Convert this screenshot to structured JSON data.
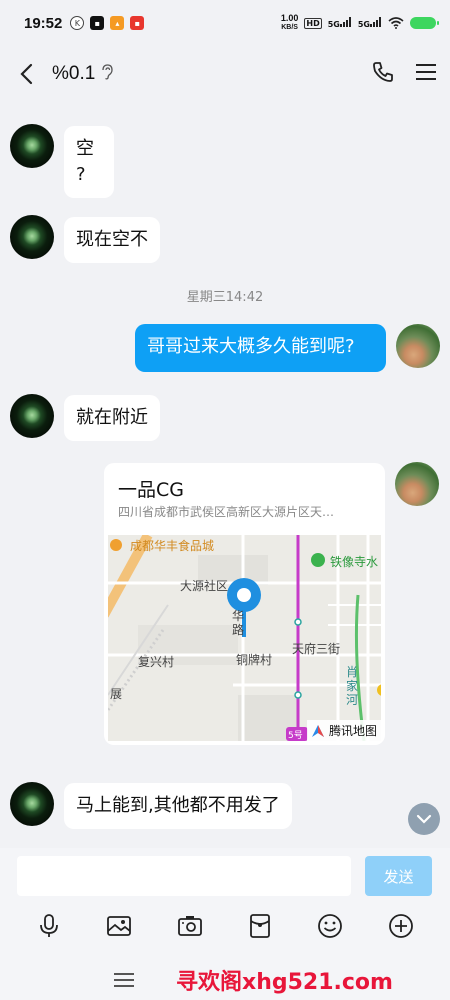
{
  "status_bar": {
    "time": "19:52",
    "net_speed_value": "1.00",
    "net_speed_unit": "KB/S",
    "hd": "HD",
    "signal_1": "5G",
    "signal_2": "5G",
    "battery_color": "#3dd65f",
    "mini_icons": [
      "k-icon",
      "app-icon-1",
      "app-icon-2",
      "app-icon-3"
    ]
  },
  "header": {
    "title": "%0.1",
    "icons": [
      "back-arrow-icon",
      "ear-icon",
      "phone-icon",
      "menu-icon"
    ]
  },
  "messages": [
    {
      "from": "friend",
      "text_line1": "空",
      "text_line2": "?"
    },
    {
      "from": "friend",
      "text": "现在空不"
    },
    {
      "type": "time",
      "text": "星期三14:42"
    },
    {
      "from": "me",
      "text": "哥哥过来大概多久能到呢?"
    },
    {
      "from": "friend",
      "text": "就在附近"
    },
    {
      "from": "me",
      "type": "location",
      "name": "一品CG",
      "address": "四川省成都市武侯区高新区大源片区天…",
      "map_labels": {
        "poi_food_city": "成都华丰食品城",
        "poi_tiexiang": "铁像寺水",
        "dayuan": "大源社区",
        "hua_lu": "华\n路",
        "tianfu": "天府三街",
        "fuxing": "复兴村",
        "tongpai": "铜牌村",
        "xiaojia": "肖\n家\n河",
        "zhan": "展",
        "line_label": "5号"
      },
      "map_brand": "腾讯地图"
    },
    {
      "from": "friend",
      "text": "马上能到,其他都不用发了"
    }
  ],
  "input": {
    "value": "",
    "send_label": "发送",
    "send_color": "#8fd0f9",
    "tools": [
      "microphone-icon",
      "image-icon",
      "camera-icon",
      "red-packet-icon",
      "emoji-icon",
      "plus-icon"
    ]
  },
  "watermark": "寻欢阁xhg521.com",
  "colors": {
    "bubble_out": "#0ea0f5",
    "bubble_in": "#ffffff",
    "background": "#f1f2f5"
  }
}
